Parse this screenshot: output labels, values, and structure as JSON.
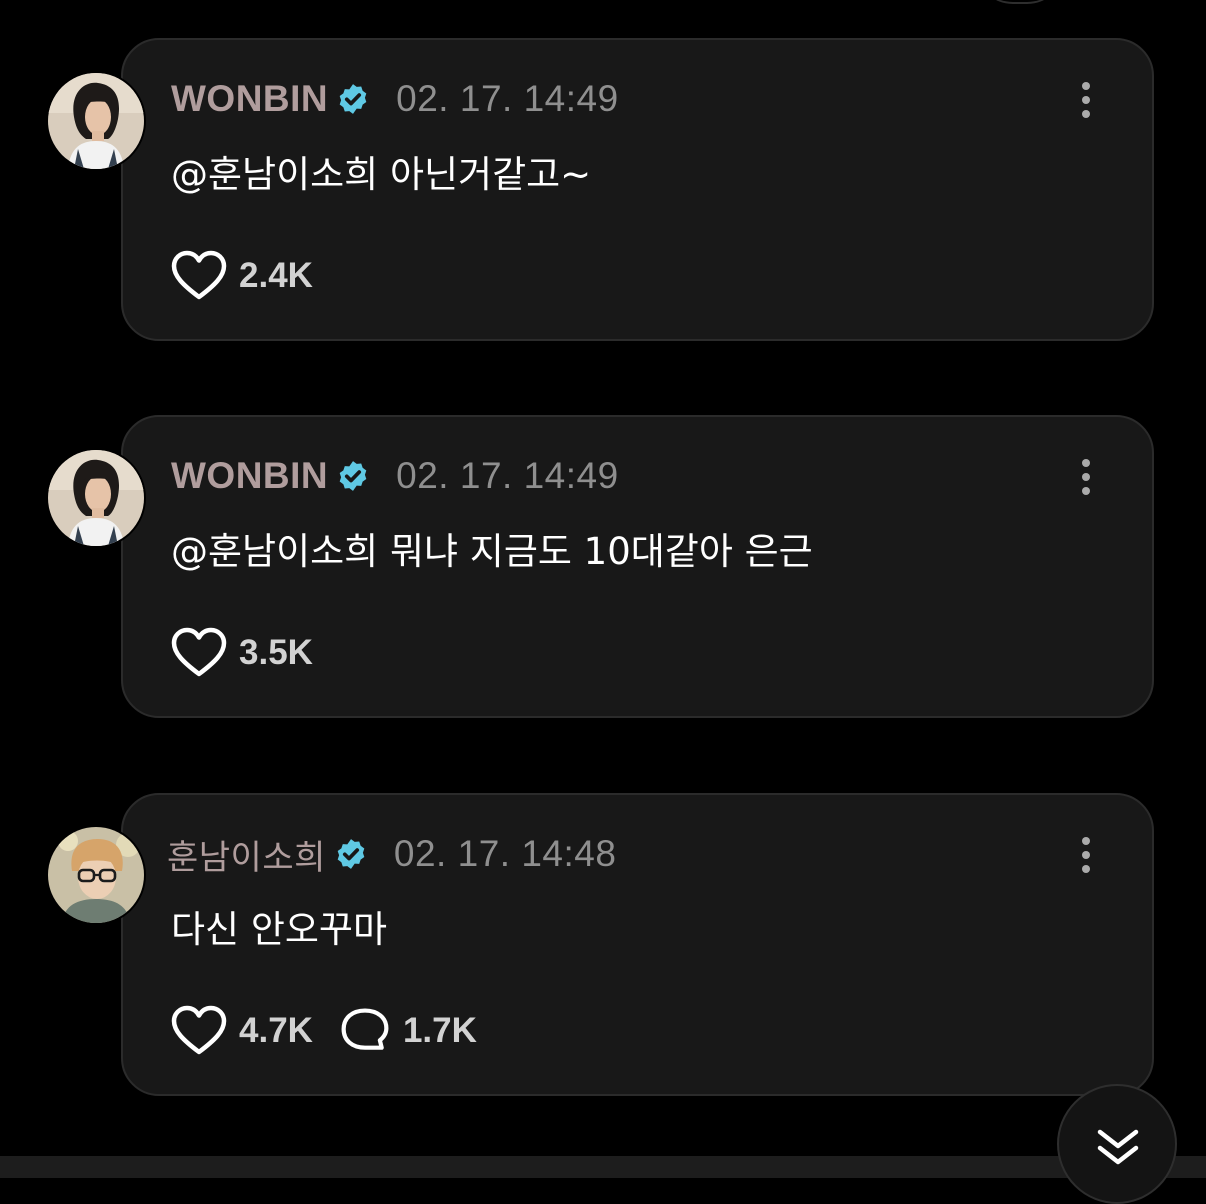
{
  "comments": [
    {
      "author": "WONBIN",
      "verified": true,
      "timestamp": "02. 17. 14:49",
      "text": "@훈남이소희 아닌거같고~",
      "likes": "2.4K",
      "avatar_icon": "profile-photo"
    },
    {
      "author": "WONBIN",
      "verified": true,
      "timestamp": "02. 17. 14:49",
      "text": "@훈남이소희 뭐냐 지금도 10대같아 은근",
      "likes": "3.5K",
      "avatar_icon": "profile-photo"
    },
    {
      "author": "훈남이소희",
      "verified": true,
      "timestamp": "02. 17. 14:48",
      "text": "다신 안오꾸마",
      "likes": "4.7K",
      "replies": "1.7K",
      "avatar_icon": "profile-photo"
    }
  ],
  "icons": {
    "verified": "verified-badge-icon",
    "like": "heart-icon",
    "reply": "comment-bubble-icon",
    "more": "more-vertical-icon",
    "scroll": "chevron-double-down-icon"
  },
  "colors": {
    "background": "#000000",
    "card": "#181818",
    "card_border": "#2b2b2b",
    "author_name": "#b09d9d",
    "timestamp": "#8f8f8f",
    "verified_badge": "#5fc9e4",
    "text": "#ffffff"
  }
}
